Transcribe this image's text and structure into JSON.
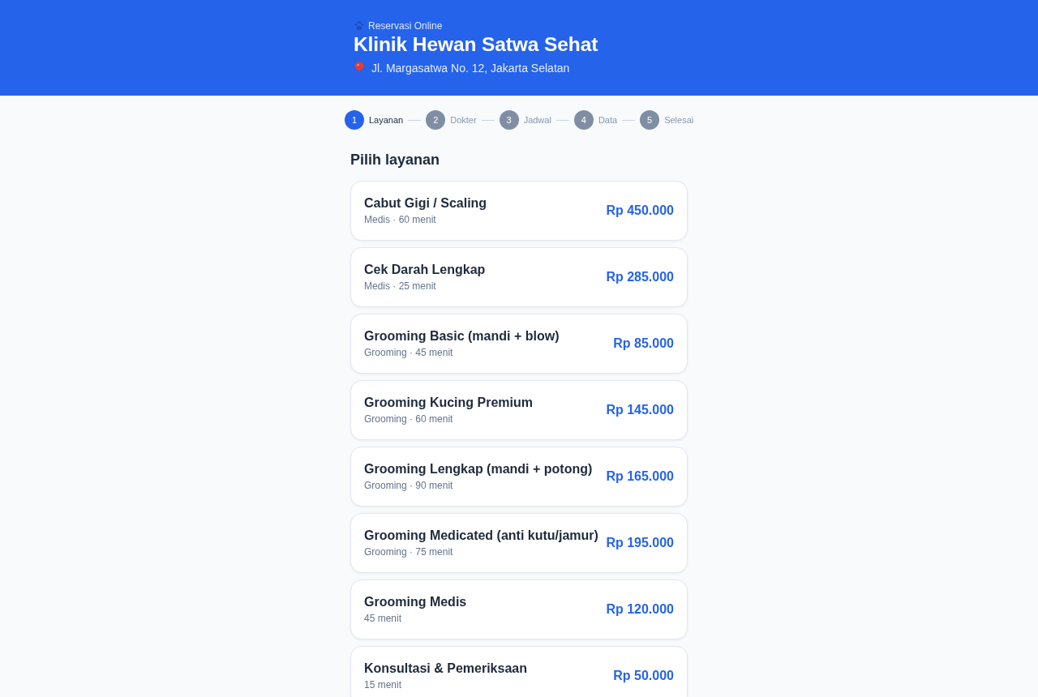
{
  "header": {
    "eyebrow": "Reservasi Online",
    "title": "Klinik Hewan Satwa Sehat",
    "address": "Jl. Margasatwa No. 12, Jakarta Selatan"
  },
  "steps": [
    {
      "number": "1",
      "label": "Layanan",
      "selected": true
    },
    {
      "number": "2",
      "label": "Dokter",
      "selected": false
    },
    {
      "number": "3",
      "label": "Jadwal",
      "selected": false
    },
    {
      "number": "4",
      "label": "Data",
      "selected": false
    },
    {
      "number": "5",
      "label": "Selesai",
      "selected": false
    }
  ],
  "section_title": "Pilih layanan",
  "services": [
    {
      "name": "Cabut Gigi / Scaling",
      "meta": "Medis · 60 menit",
      "price": "Rp 450.000"
    },
    {
      "name": "Cek Darah Lengkap",
      "meta": "Medis · 25 menit",
      "price": "Rp 285.000"
    },
    {
      "name": "Grooming Basic (mandi + blow)",
      "meta": "Grooming · 45 menit",
      "price": "Rp 85.000"
    },
    {
      "name": "Grooming Kucing Premium",
      "meta": "Grooming · 60 menit",
      "price": "Rp 145.000"
    },
    {
      "name": "Grooming Lengkap (mandi + potong)",
      "meta": "Grooming · 90 menit",
      "price": "Rp 165.000"
    },
    {
      "name": "Grooming Medicated (anti kutu/jamur)",
      "meta": "Grooming · 75 menit",
      "price": "Rp 195.000"
    },
    {
      "name": "Grooming Medis",
      "meta": "45 menit",
      "price": "Rp 120.000"
    },
    {
      "name": "Konsultasi & Pemeriksaan",
      "meta": "15 menit",
      "price": "Rp 50.000"
    }
  ]
}
